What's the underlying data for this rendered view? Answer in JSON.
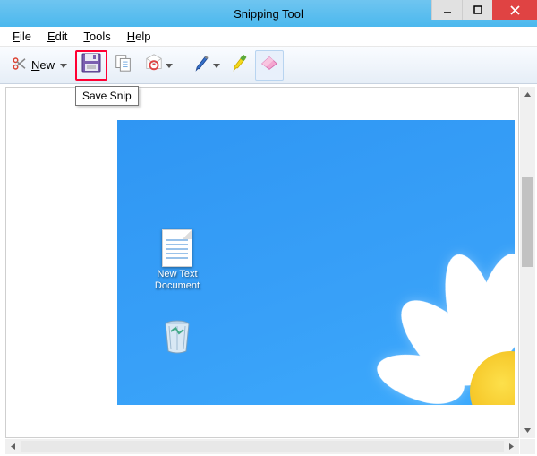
{
  "window": {
    "title": "Snipping Tool"
  },
  "menu": {
    "items": [
      {
        "label": "File",
        "underline": 0
      },
      {
        "label": "Edit",
        "underline": 0
      },
      {
        "label": "Tools",
        "underline": 0
      },
      {
        "label": "Help",
        "underline": 0
      }
    ]
  },
  "toolbar": {
    "new_label": "New",
    "tooltip": "Save Snip",
    "icons": {
      "new": "scissors-icon",
      "save": "floppy-icon",
      "copy": "copy-icon",
      "send": "send-icon",
      "pen": "pen-icon",
      "highlighter": "highlighter-icon",
      "eraser": "eraser-icon"
    }
  },
  "snip": {
    "desktop_items": [
      {
        "name": "New Text Document",
        "type": "txt"
      },
      {
        "name": "",
        "type": "recycle-bin"
      }
    ]
  },
  "colors": {
    "titlebar": "#4BB8EE",
    "close": "#E04343",
    "highlight": "#FF0033",
    "desktop": "#2F96F3",
    "flower_center": "#F4C221"
  }
}
